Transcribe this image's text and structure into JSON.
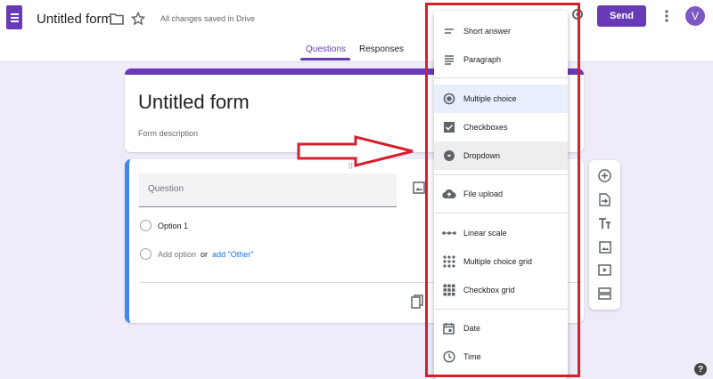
{
  "header": {
    "form_title": "Untitled form",
    "saved_status": "All changes saved in Drive",
    "send_label": "Send",
    "avatar_letter": "V",
    "tabs": [
      {
        "label": "Questions"
      },
      {
        "label": "Responses"
      }
    ]
  },
  "form": {
    "title": "Untitled form",
    "description": "Form description"
  },
  "question": {
    "placeholder": "Question",
    "option_1": "Option 1",
    "add_option": "Add option",
    "or": "or",
    "add_other": "add \"Other\""
  },
  "menu": {
    "items": [
      {
        "label": "Short answer",
        "icon": "short-answer-icon"
      },
      {
        "label": "Paragraph",
        "icon": "paragraph-icon"
      },
      {
        "label": "Multiple choice",
        "icon": "radio-icon",
        "state": "selected"
      },
      {
        "label": "Checkboxes",
        "icon": "checkbox-icon"
      },
      {
        "label": "Dropdown",
        "icon": "dropdown-icon",
        "state": "hover"
      },
      {
        "label": "File upload",
        "icon": "cloud-upload-icon"
      },
      {
        "label": "Linear scale",
        "icon": "linear-scale-icon"
      },
      {
        "label": "Multiple choice grid",
        "icon": "dots-grid-icon"
      },
      {
        "label": "Checkbox grid",
        "icon": "square-grid-icon"
      },
      {
        "label": "Date",
        "icon": "calendar-icon"
      },
      {
        "label": "Time",
        "icon": "clock-icon"
      }
    ]
  },
  "colors": {
    "accent": "#673ab7",
    "highlight": "#d4202a",
    "question_border": "#4285f4",
    "link": "#1a73e8"
  },
  "help_label": "?"
}
